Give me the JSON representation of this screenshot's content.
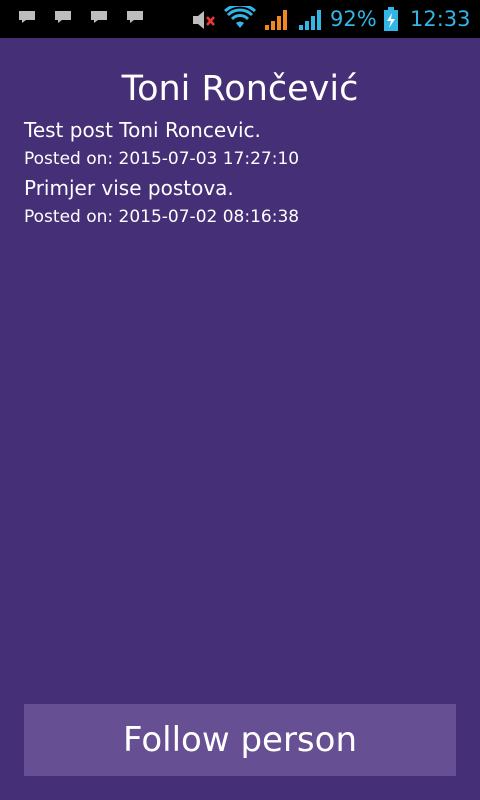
{
  "status_bar": {
    "notification_icons": [
      "chat-bubble-icon",
      "chat-bubble-icon",
      "chat-bubble-icon",
      "chat-bubble-icon"
    ],
    "icons": [
      "speaker-muted-icon",
      "wifi-icon",
      "cellular-signal-icon",
      "cellular-signal-icon",
      "battery-charging-icon"
    ],
    "battery_percent": "92%",
    "time": "12:33"
  },
  "profile": {
    "name": "Toni Rončević"
  },
  "posts": [
    {
      "text": "Test post Toni Roncevic.",
      "date": "Posted on: 2015-07-03 17:27:10"
    },
    {
      "text": "Primjer vise postova.",
      "date": "Posted on: 2015-07-02 08:16:38"
    }
  ],
  "actions": {
    "follow_label": "Follow person"
  },
  "colors": {
    "background": "#452f77",
    "button": "#664f93",
    "status_accent": "#33b5e5",
    "signal_orange": "#f08a1e"
  }
}
